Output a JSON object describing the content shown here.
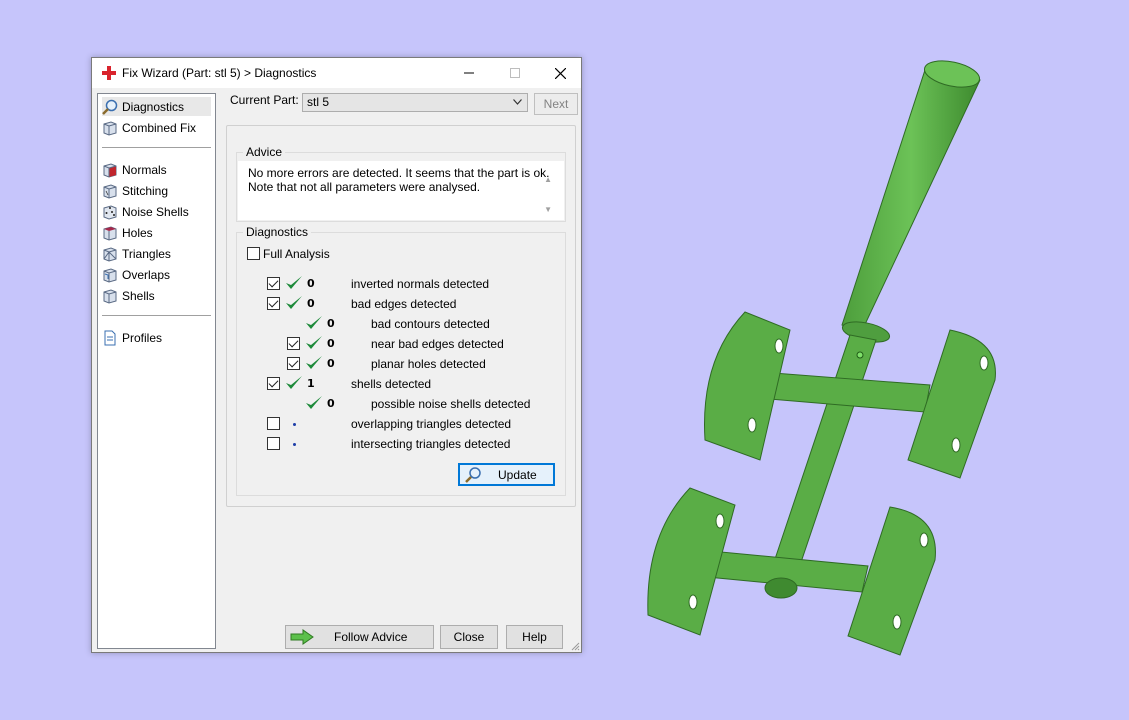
{
  "window": {
    "title": "Fix Wizard (Part: stl 5) > Diagnostics",
    "icons": {
      "app": "red-cross-icon",
      "minimize": "minimize-icon",
      "maximize": "maximize-icon",
      "close": "close-icon"
    }
  },
  "sidebar": {
    "group1": [
      {
        "label": "Diagnostics",
        "icon": "magnifier-icon"
      },
      {
        "label": "Combined Fix",
        "icon": "cube-icon"
      }
    ],
    "group2": [
      {
        "label": "Normals",
        "icon": "cube-red-face-icon"
      },
      {
        "label": "Stitching",
        "icon": "cube-icon"
      },
      {
        "label": "Noise Shells",
        "icon": "dice-icon"
      },
      {
        "label": "Holes",
        "icon": "cube-hole-icon"
      },
      {
        "label": "Triangles",
        "icon": "cube-triangle-icon"
      },
      {
        "label": "Overlaps",
        "icon": "cube-overlap-icon"
      },
      {
        "label": "Shells",
        "icon": "cube-shell-icon"
      }
    ],
    "group3": [
      {
        "label": "Profiles",
        "icon": "document-icon"
      }
    ]
  },
  "current_part": {
    "label": "Current Part:",
    "value": "stl 5"
  },
  "next_button": "Next",
  "advice": {
    "title": "Advice",
    "line1": "No more errors are detected. It seems that the part is ok.",
    "line2": "Note that not all parameters were analysed."
  },
  "diagnostics": {
    "title": "Diagnostics",
    "full_analysis": {
      "label": "Full Analysis",
      "checked": false
    },
    "rows": [
      {
        "checkbox": true,
        "checked": true,
        "status": "ok",
        "count": "0",
        "label": "inverted normals detected",
        "indent": 0
      },
      {
        "checkbox": true,
        "checked": true,
        "status": "ok",
        "count": "0",
        "label": "bad edges detected",
        "indent": 0
      },
      {
        "checkbox": false,
        "checked": false,
        "status": "ok",
        "count": "0",
        "label": "bad contours detected",
        "indent": 1
      },
      {
        "checkbox": true,
        "checked": true,
        "status": "ok",
        "count": "0",
        "label": "near bad edges detected",
        "indent": 1
      },
      {
        "checkbox": true,
        "checked": true,
        "status": "ok",
        "count": "0",
        "label": "planar holes detected",
        "indent": 1
      },
      {
        "checkbox": true,
        "checked": true,
        "status": "ok",
        "count": "1",
        "label": "shells detected",
        "indent": 0
      },
      {
        "checkbox": false,
        "checked": false,
        "status": "ok",
        "count": "0",
        "label": "possible noise shells detected",
        "indent": 1
      },
      {
        "checkbox": true,
        "checked": false,
        "status": "pending",
        "count": "",
        "label": "overlapping triangles detected",
        "indent": 0
      },
      {
        "checkbox": true,
        "checked": false,
        "status": "pending",
        "count": "",
        "label": "intersecting triangles detected",
        "indent": 0
      }
    ],
    "update_button": "Update"
  },
  "footer": {
    "follow_advice": "Follow Advice",
    "close": "Close",
    "help": "Help"
  },
  "colors": {
    "background": "#c6c5fb",
    "model_green": "#5bae48",
    "check_green": "#1d8a3a",
    "accent_blue": "#0078d7"
  }
}
